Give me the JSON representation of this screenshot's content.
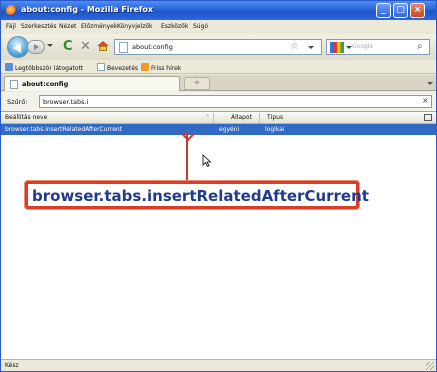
{
  "window": {
    "title": "about:config - Mozilla Firefox",
    "controls": [
      "minimize",
      "maximize",
      "close"
    ]
  },
  "menu": {
    "items": [
      "Fájl",
      "Szerkesztés",
      "Nézet",
      "Előzmények",
      "Könyvjelzők",
      "Eszközök",
      "Súgó"
    ]
  },
  "navbar": {
    "url": "about:config",
    "search_placeholder": "Google",
    "icons": [
      "back-icon",
      "forward-icon",
      "reload-icon",
      "stop-icon",
      "home-icon",
      "star-icon",
      "magnifier-icon"
    ]
  },
  "bookmarks": {
    "items": [
      "Legtöbbször látogatott",
      "Bevezetés",
      "Friss hírek"
    ]
  },
  "tabs": {
    "active": "about:config",
    "new_tab_symbol": "+"
  },
  "filter": {
    "label": "Szűrő:",
    "value": "browser.tabs.i",
    "clear_symbol": "×"
  },
  "table": {
    "columns": [
      "Beállítás neve",
      "Állapot",
      "Típus"
    ],
    "rows": [
      {
        "name": "browser.tabs.insertRelatedAfterCurrent",
        "state": "egyéni",
        "type": "logikai",
        "selected": true
      }
    ]
  },
  "callout": {
    "text": "browser.tabs.insertRelatedAfterCurrent",
    "border_color": "#d73d27",
    "text_color": "#1f3c8c"
  },
  "status": {
    "text": "Kész"
  },
  "colors": {
    "selection": "#316ac5",
    "titlebar": "#2a63d6"
  }
}
